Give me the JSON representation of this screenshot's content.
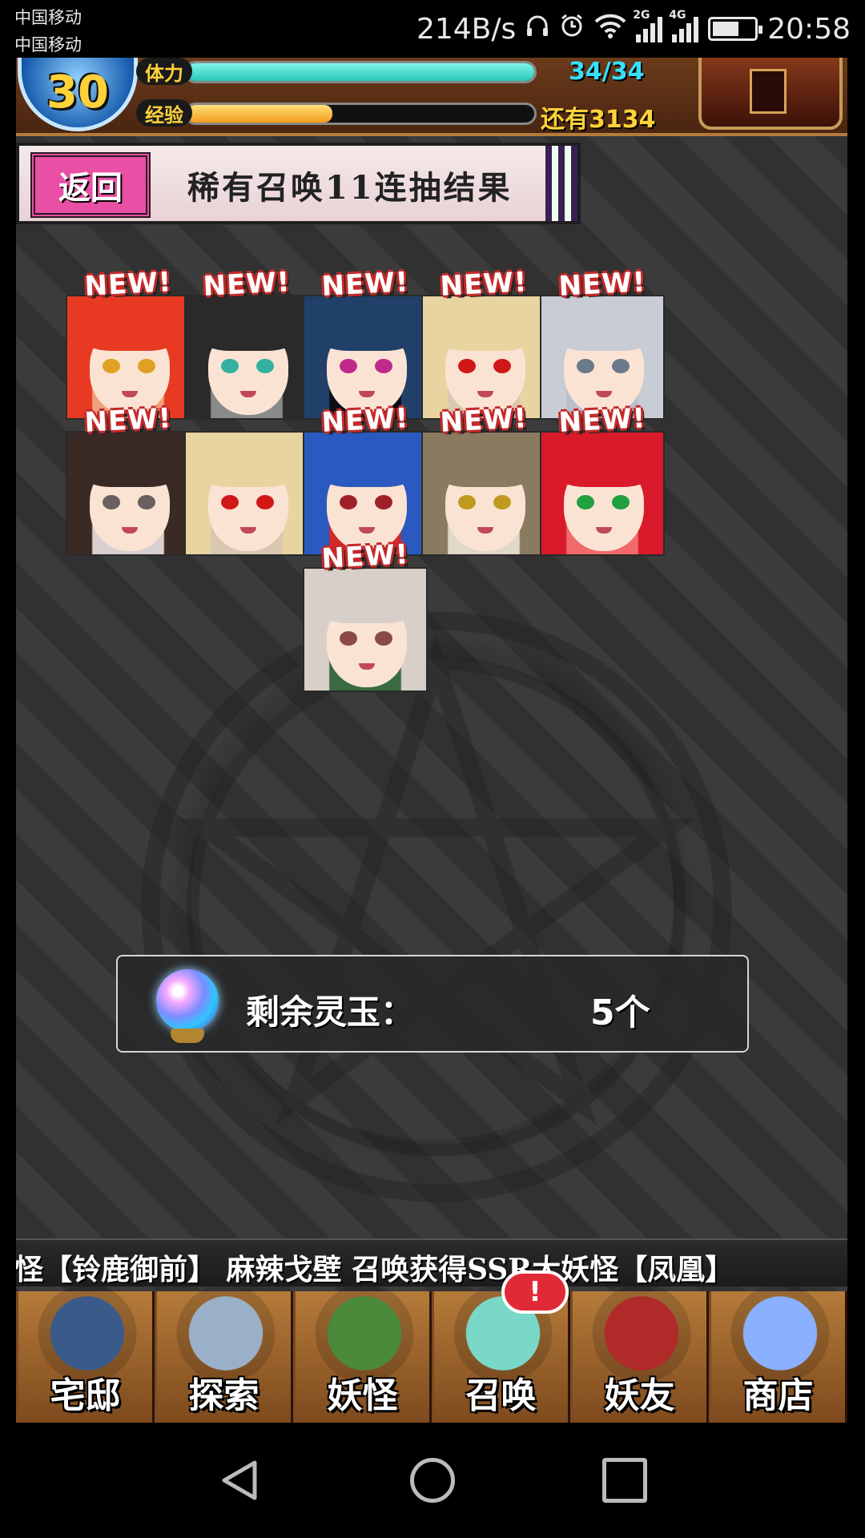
{
  "status_bar": {
    "carrier_1": "中国移动",
    "carrier_2": "中国移动",
    "net_speed": "214B/s",
    "sim1_type": "2G",
    "sim2_type": "4G",
    "time": "20:58",
    "icons": [
      "headphones-icon",
      "alarm-icon",
      "wifi-icon",
      "signal-icon",
      "battery-icon"
    ]
  },
  "hud": {
    "level": "30",
    "hp_label": "体力",
    "hp_value": "34/34",
    "hp_fraction": 1.0,
    "exp_label": "经验",
    "exp_value": "还有3134",
    "exp_fraction": 0.42
  },
  "banner": {
    "back_label": "返回",
    "title": "稀有召唤11连抽结果"
  },
  "results": {
    "new_label": "NEW!",
    "cards": [
      {
        "is_new": true,
        "hair": "#e83a22",
        "bg": "#f0a07a",
        "eye": "#e0a020"
      },
      {
        "is_new": true,
        "hair": "#2a2a2a",
        "bg": "#8a8a8a",
        "eye": "#33b0a0"
      },
      {
        "is_new": true,
        "hair": "#20406a",
        "bg": "#0c0c14",
        "eye": "#c02a8a"
      },
      {
        "is_new": true,
        "hair": "#e8d4a0",
        "bg": "#d8c8b0",
        "eye": "#d01818"
      },
      {
        "is_new": true,
        "hair": "#c8ccd4",
        "bg": "#b8c0cc",
        "eye": "#6a7a8a"
      },
      {
        "is_new": true,
        "hair": "#3a2a26",
        "bg": "#d8d0d0",
        "eye": "#6a6060"
      },
      {
        "is_new": false,
        "hair": "#e8d4a0",
        "bg": "#d8c8b0",
        "eye": "#d01818"
      },
      {
        "is_new": true,
        "hair": "#2a5ac0",
        "bg": "#d02a2a",
        "eye": "#a0202a"
      },
      {
        "is_new": true,
        "hair": "#8a7a60",
        "bg": "#e0d8c8",
        "eye": "#c09a20"
      },
      {
        "is_new": true,
        "hair": "#d81a2a",
        "bg": "#f06a6a",
        "eye": "#20a040"
      },
      {
        "is_new": true,
        "hair": "#d8d0c8",
        "bg": "#3a6a40",
        "eye": "#8a4a4a"
      }
    ]
  },
  "jade": {
    "label": "剩余灵玉：",
    "value": "5个"
  },
  "ticker": {
    "text": "怪【铃鹿御前】    麻辣戈壁 召唤获得SSR大妖怪【凤凰】"
  },
  "nav": {
    "items": [
      {
        "label": "宅邸",
        "icon": "mansion-icon",
        "color": "#3a5a8a"
      },
      {
        "label": "探索",
        "icon": "magnifier-icon",
        "color": "#9ab0c8"
      },
      {
        "label": "妖怪",
        "icon": "scroll-icon",
        "color": "#4a8a3a"
      },
      {
        "label": "召唤",
        "icon": "pentagram-icon",
        "color": "#7ad8c8",
        "badge": "!"
      },
      {
        "label": "妖友",
        "icon": "fox-girl-icon",
        "color": "#b02a2a"
      },
      {
        "label": "商店",
        "icon": "orb-icon",
        "color": "#8ab0ff"
      }
    ]
  },
  "system_nav": {
    "icons": [
      "back-triangle-icon",
      "home-circle-icon",
      "recents-square-icon"
    ]
  }
}
